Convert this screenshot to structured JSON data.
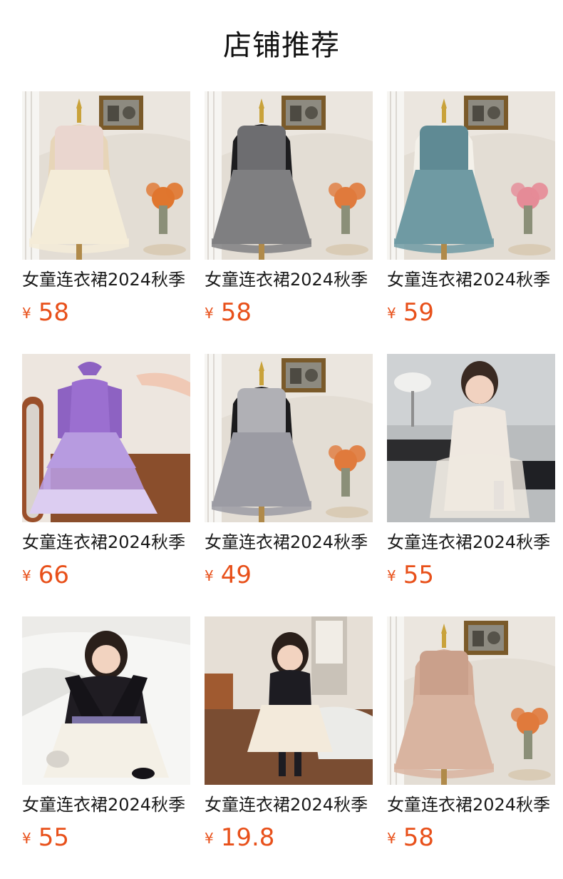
{
  "header": {
    "title": "店铺推荐"
  },
  "products": [
    {
      "name": "女童连衣裙2024秋季",
      "currency": "¥",
      "price": "58",
      "scene": "mannequin",
      "dress": "#f4ecd8",
      "sleeve": "#e7d5b8",
      "top": "#ead6cf",
      "flowers": "#e0762e"
    },
    {
      "name": "女童连衣裙2024秋季",
      "currency": "¥",
      "price": "58",
      "scene": "mannequin",
      "dress": "#7f7f81",
      "sleeve": "#1d1d1f",
      "top": "#6d6d70",
      "flowers": "#e07a3c"
    },
    {
      "name": "女童连衣裙2024秋季",
      "currency": "¥",
      "price": "59",
      "scene": "mannequin",
      "dress": "#6f9aa3",
      "sleeve": "#f4f1ea",
      "top": "#5f8a94",
      "flowers": "#e58b97"
    },
    {
      "name": "女童连衣裙2024秋季",
      "currency": "¥",
      "price": "66",
      "scene": "hanger",
      "dress": "#b79be0",
      "sleeve": "#8d62c2",
      "top": "#9b6fd0",
      "flowers": "#d9a06b"
    },
    {
      "name": "女童连衣裙2024秋季",
      "currency": "¥",
      "price": "49",
      "scene": "mannequin",
      "dress": "#9b9ba3",
      "sleeve": "#1b1b1d",
      "top": "#b0b0b5",
      "flowers": "#e07a3c"
    },
    {
      "name": "女童连衣裙2024秋季",
      "currency": "¥",
      "price": "55",
      "scene": "girl-sitting",
      "dress": "#efe8e0",
      "sleeve": "#f2ece6",
      "top": "#efe8e0",
      "flowers": "#cccccc"
    },
    {
      "name": "女童连衣裙2024秋季",
      "currency": "¥",
      "price": "55",
      "scene": "girl-bed",
      "dress": "#f4f0e6",
      "sleeve": "#151318",
      "top": "#1f1c22",
      "flowers": "#cccccc"
    },
    {
      "name": "女童连衣裙2024秋季",
      "currency": "¥",
      "price": "19.8",
      "scene": "girl-room",
      "dress": "#f3eadb",
      "sleeve": "#f3eadb",
      "top": "#1d1c22",
      "flowers": "#cccccc"
    },
    {
      "name": "女童连衣裙2024秋季",
      "currency": "¥",
      "price": "58",
      "scene": "mannequin",
      "dress": "#d9b4a0",
      "sleeve": "#d3ab96",
      "top": "#caa08b",
      "flowers": "#e07a3c"
    }
  ],
  "colors": {
    "price": "#e8501a",
    "title": "#111111"
  }
}
